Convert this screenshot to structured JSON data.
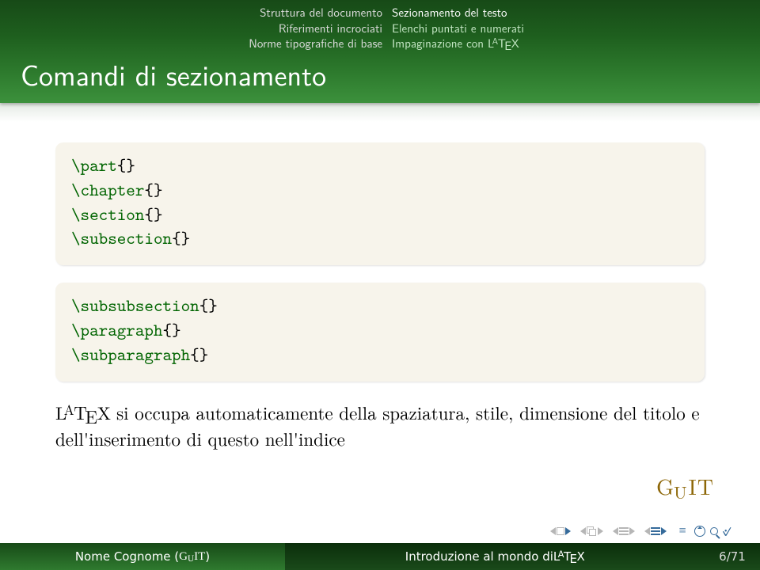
{
  "header": {
    "nav_left": [
      "Struttura del documento",
      "Riferimenti incrociati",
      "Norme tipografiche di base"
    ],
    "nav_right": [
      {
        "label": "Sezionamento del testo",
        "active": true
      },
      {
        "label": "Elenchi puntati e numerati",
        "active": false
      },
      {
        "label": "Impaginazione con L A T E X",
        "active": false,
        "latex": true
      }
    ],
    "title": "Comandi di sezionamento"
  },
  "box1": {
    "lines": [
      {
        "cmd": "\\part",
        "arg": "{}"
      },
      {
        "cmd": "\\chapter",
        "arg": "{}"
      },
      {
        "cmd": "\\section",
        "arg": "{}"
      },
      {
        "cmd": "\\subsection",
        "arg": "{}"
      }
    ]
  },
  "box2": {
    "lines": [
      {
        "cmd": "\\subsubsection",
        "arg": "{}"
      },
      {
        "cmd": "\\paragraph",
        "arg": "{}"
      },
      {
        "cmd": "\\subparagraph",
        "arg": "{}"
      }
    ]
  },
  "body": {
    "after_latex": " si occupa automaticamente della spaziatura, stile, dimensione del titolo e dell'inserimento di questo nell'indice"
  },
  "logo": "G U I T",
  "footer": {
    "author_pre": "Nome Cognome (",
    "author_guit": "G u I T",
    "author_post": ")",
    "title_pre": "Introduzione al mondo di ",
    "page": "6/71"
  }
}
